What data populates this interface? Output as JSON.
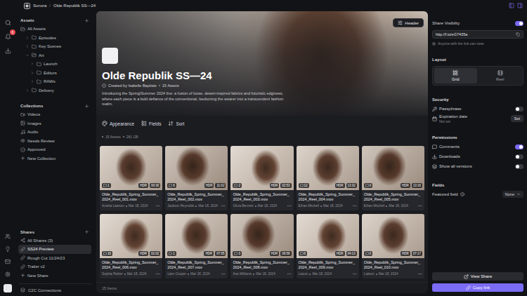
{
  "topbar": {
    "app": "Sonora",
    "separator": "/",
    "page": "Olde Republik SS—24"
  },
  "rail": {
    "notifications": "6"
  },
  "sidebar": {
    "assets": {
      "title": "Assets",
      "items": [
        {
          "label": "All Assets",
          "depth": 0,
          "kind": "root",
          "expanded": true,
          "selected": false
        },
        {
          "label": "Episodes",
          "depth": 1,
          "kind": "folder",
          "expanded": false,
          "selected": false
        },
        {
          "label": "Key Scenes",
          "depth": 1,
          "kind": "folder",
          "expanded": false,
          "selected": false
        },
        {
          "label": "Art",
          "depth": 1,
          "kind": "folder",
          "expanded": true,
          "selected": false
        },
        {
          "label": "Launch",
          "depth": 2,
          "kind": "folder",
          "expanded": false,
          "selected": false
        },
        {
          "label": "Editors",
          "depth": 2,
          "kind": "folder",
          "expanded": false,
          "selected": false
        },
        {
          "label": "RAWs",
          "depth": 2,
          "kind": "folder",
          "expanded": false,
          "selected": false
        },
        {
          "label": "Delivery",
          "depth": 1,
          "kind": "folder",
          "expanded": false,
          "selected": false
        }
      ]
    },
    "collections": {
      "title": "Collections",
      "items": [
        {
          "label": "Videos",
          "kind": "collection",
          "selected": false
        },
        {
          "label": "Images",
          "kind": "collection",
          "selected": false
        },
        {
          "label": "Audio",
          "kind": "collection",
          "selected": false
        },
        {
          "label": "Needs Review",
          "kind": "collection",
          "selected": false
        },
        {
          "label": "Approved",
          "kind": "collection",
          "selected": false
        },
        {
          "label": "New Collection",
          "kind": "add",
          "selected": false
        }
      ]
    },
    "shares": {
      "title": "Shares",
      "items": [
        {
          "label": "All Shares (3)",
          "kind": "all",
          "selected": false
        },
        {
          "label": "SS24 Preview",
          "kind": "share",
          "selected": true
        },
        {
          "label": "Rough Cut 11/24/23",
          "kind": "share",
          "selected": false
        },
        {
          "label": "Trailer v2",
          "kind": "share",
          "selected": false
        },
        {
          "label": "New Share",
          "kind": "add",
          "selected": false
        }
      ]
    },
    "footer": "C2C Connections"
  },
  "hero": {
    "header_button": "Header",
    "title": "Olde Republik SS—24",
    "created_by": "Created by Isabelle Baptiste",
    "asset_count": "15 Assets",
    "description": "Introducing the Spring/Summer 2024 line: a fusion of loose, desert-inspired fabrics and futuristic edginess, where each piece is a bold defiance of the conventional, beckoning the wearer into a transcendent fashion realm."
  },
  "toolbar": [
    "Appearance",
    "Fields",
    "Sort"
  ],
  "summary": {
    "assets": "15 Assets",
    "size": "281 GB"
  },
  "cards": [
    {
      "filename": "Olde_Republik_Spring_Summer_2024_Reel_001.mov",
      "comments": "1",
      "hdr": "HDR",
      "duration": "00:30",
      "author": "Amelia Lawson",
      "date": "Mar 18, 2024"
    },
    {
      "filename": "Olde_Republik_Spring_Summer_2024_Reel_002.mov",
      "comments": "6",
      "hdr": "HDR",
      "duration": "11:02",
      "author": "Jackson Reynolds",
      "date": "Mar 18, 2024"
    },
    {
      "filename": "Olde_Republik_Spring_Summer_2024_Reel_003.mov",
      "comments": "2",
      "hdr": "HDR",
      "duration": "02:53",
      "author": "Olivia Bennett",
      "date": "Mar 18, 2024"
    },
    {
      "filename": "Olde_Republik_Spring_Summer_2024_Reel_004.mov",
      "comments": "12",
      "hdr": "HDR",
      "duration": "13:32",
      "author": "Ethan Mitchell",
      "date": "Mar 18, 2024"
    },
    {
      "filename": "Olde_Republik_Spring_Summer_2024_Reel_005.mov",
      "comments": "0",
      "hdr": "HDR",
      "duration": "13:16",
      "author": "Ethan Mitchell",
      "date": "Mar 18, 2024"
    },
    {
      "filename": "Olde_Republik_Spring_Summer_2024_Reel_006.mov",
      "comments": "16",
      "hdr": "HDR",
      "duration": "02:02",
      "author": "Sophia Parker",
      "date": "Mar 18, 2024"
    },
    {
      "filename": "Olde_Republik_Spring_Summer_2024_Reel_007.mov",
      "comments": "1",
      "hdr": "HDR",
      "duration": "07:05",
      "author": "Liam Cooper",
      "date": "Mar 18, 2024"
    },
    {
      "filename": "Olde_Republik_Spring_Summer_2024_Reel_008.mov",
      "comments": "0",
      "hdr": "HDR",
      "duration": "09:58",
      "author": "Ava Williams",
      "date": "Mar 18, 2024"
    },
    {
      "filename": "Olde_Republik_Spring_Summer_2024_Reel_009.mov",
      "comments": "6",
      "hdr": "HDR",
      "duration": "04:13",
      "author": "Liacon",
      "date": "Mar 18, 2024"
    },
    {
      "filename": "Olde_Republik_Spring_Summer_2024_Reel_010.mov",
      "comments": "0",
      "hdr": "HDR",
      "duration": "07:17",
      "author": "Liaison",
      "date": "Mar 18, 2024"
    }
  ],
  "footer": "15 Items",
  "panel": {
    "share_visibility": {
      "label": "Share Visibility",
      "on": true
    },
    "link": "http://f.io/eG7435a",
    "link_note": "Anyone with the link can view",
    "layout": {
      "title": "Layout",
      "options": [
        {
          "label": "Grid",
          "selected": true
        },
        {
          "label": "Reel",
          "selected": false
        }
      ]
    },
    "security": {
      "title": "Security",
      "passphrase": {
        "label": "Passphrase",
        "on": false
      },
      "expiration": {
        "label": "Expiration date",
        "value": "Not set",
        "button": "Set"
      }
    },
    "permissions": {
      "title": "Permissions",
      "items": [
        {
          "label": "Comments",
          "on": true
        },
        {
          "label": "Downloads",
          "on": false
        },
        {
          "label": "Show all versions",
          "on": false
        }
      ]
    },
    "fields": {
      "title": "Fields",
      "featured_label": "Featured field",
      "featured_value": "None"
    },
    "buttons": [
      {
        "label": "View Share",
        "kind": "secondary"
      },
      {
        "label": "Copy link",
        "kind": "primary"
      }
    ]
  }
}
